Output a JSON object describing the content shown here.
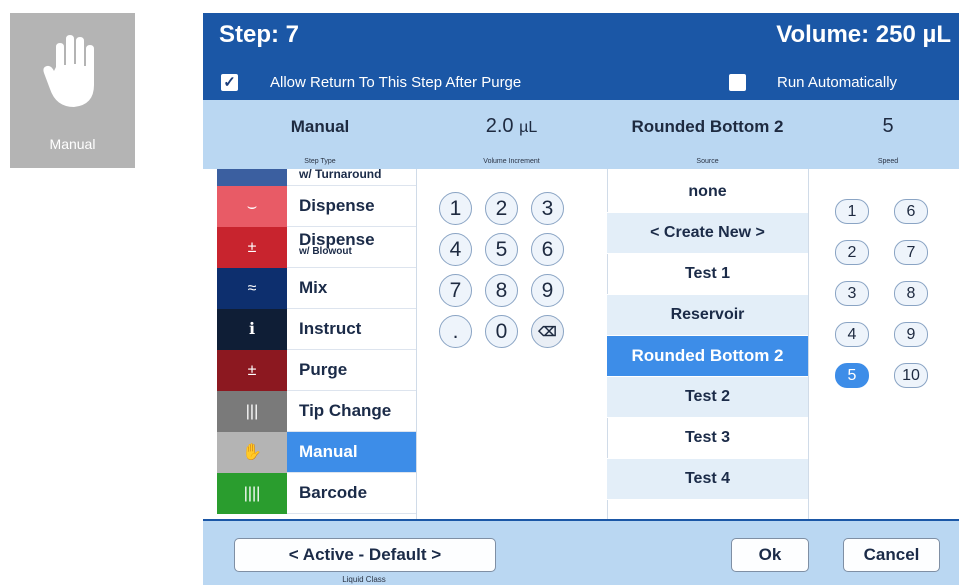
{
  "side_button": {
    "label": "Manual",
    "icon": "hand-icon",
    "color": "#b4b4b4"
  },
  "header": {
    "step": "Step: 7",
    "volume": "Volume: 250 µL",
    "allow_return": {
      "label": "Allow Return To This Step After Purge",
      "checked": true
    },
    "run_auto": {
      "label": "Run Automatically",
      "checked": false
    },
    "color": "#1b57a6"
  },
  "summary": {
    "step_type": {
      "value": "Manual",
      "label": "Step Type"
    },
    "volume_increment": {
      "value": "2.0",
      "unit": "µL",
      "label": "Volume Increment"
    },
    "source": {
      "value": "Rounded Bottom 2",
      "label": "Source"
    },
    "speed": {
      "value": "5",
      "label": "Speed"
    }
  },
  "step_types": [
    {
      "label": "w/ Turnaround",
      "sub": "",
      "icon": "plus-icon",
      "color": "#3b5fa0",
      "glyph": "+"
    },
    {
      "label": "Dispense",
      "sub": "",
      "icon": "dispense-icon",
      "color": "#e85b66",
      "glyph": "⌣"
    },
    {
      "label": "Dispense",
      "sub": "w/ Blowout",
      "icon": "dispense-blowout-icon",
      "color": "#c8242e",
      "glyph": "±"
    },
    {
      "label": "Mix",
      "sub": "",
      "icon": "mix-icon",
      "color": "#0d2f6e",
      "glyph": "≈"
    },
    {
      "label": "Instruct",
      "sub": "",
      "icon": "instruct-icon",
      "color": "#0f1e36",
      "glyph": "ℹ"
    },
    {
      "label": "Purge",
      "sub": "",
      "icon": "purge-icon",
      "color": "#8c1820",
      "glyph": "±"
    },
    {
      "label": "Tip Change",
      "sub": "",
      "icon": "tip-change-icon",
      "color": "#7a7a7a",
      "glyph": "|||"
    },
    {
      "label": "Manual",
      "sub": "",
      "icon": "hand-icon",
      "color": "#b4b4b4",
      "glyph": "✋",
      "selected": true
    },
    {
      "label": "Barcode",
      "sub": "",
      "icon": "barcode-icon",
      "color": "#2a9d2e",
      "glyph": "||||"
    }
  ],
  "keypad": [
    "1",
    "2",
    "3",
    "4",
    "5",
    "6",
    "7",
    "8",
    "9",
    ".",
    "0",
    "⌫"
  ],
  "sources": [
    {
      "label": "none"
    },
    {
      "label": "< Create New >"
    },
    {
      "label": "Test 1"
    },
    {
      "label": "Reservoir"
    },
    {
      "label": "Rounded Bottom 2",
      "selected": true
    },
    {
      "label": "Test 2"
    },
    {
      "label": "Test 3"
    },
    {
      "label": "Test 4"
    }
  ],
  "speeds": [
    "1",
    "6",
    "2",
    "7",
    "3",
    "8",
    "4",
    "9",
    "5",
    "10"
  ],
  "speed_selected": "5",
  "footer": {
    "liquid_class": "< Active - Default >",
    "liquid_class_label": "Liquid Class",
    "ok": "Ok",
    "cancel": "Cancel"
  },
  "accent": "#3d8de8"
}
